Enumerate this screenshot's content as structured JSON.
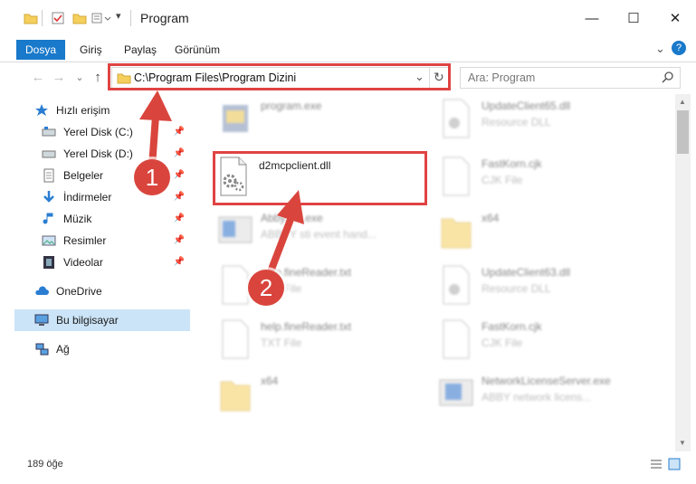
{
  "window": {
    "title": "Program",
    "minimize": "—",
    "maximize": "☐",
    "close": "✕"
  },
  "ribbon": {
    "tabs": [
      "Dosya",
      "Giriş",
      "Paylaş",
      "Görünüm"
    ],
    "expand": "⌄",
    "help": "?"
  },
  "navbar": {
    "back": "←",
    "forward": "→",
    "recent": "⌄",
    "up": "↑",
    "address": "C:\\Program Files\\Program Dizini",
    "dropdown": "⌄",
    "refresh": "↻",
    "search_placeholder": "Ara: Program"
  },
  "sidebar": {
    "quick_access": "Hızlı erişim",
    "items": [
      {
        "label": "Yerel Disk (C:)",
        "pinned": true
      },
      {
        "label": "Yerel Disk (D:)",
        "pinned": true
      },
      {
        "label": "Belgeler",
        "pinned": true
      },
      {
        "label": "İndirmeler",
        "pinned": true
      },
      {
        "label": "Müzik",
        "pinned": true
      },
      {
        "label": "Resimler",
        "pinned": true
      },
      {
        "label": "Videolar",
        "pinned": true
      }
    ],
    "onedrive": "OneDrive",
    "this_pc": "Bu bilgisayar",
    "network": "Ağ"
  },
  "files": [
    {
      "name": "program.exe",
      "type": ""
    },
    {
      "name": "UpdateClient65.dll",
      "type": "Resource DLL"
    },
    {
      "name": "d2mcpclient.dll",
      "type": ""
    },
    {
      "name": "FastKorn.cjk",
      "type": "CJK File"
    },
    {
      "name": "AbbySTI.exe",
      "type": "ABBYY sti event hand..."
    },
    {
      "name": "x64",
      "type": ""
    },
    {
      "name": "help.fineReader.txt",
      "type": "TXT File"
    },
    {
      "name": "UpdateClient63.dll",
      "type": "Resource DLL"
    },
    {
      "name": "help.fineReader.txt",
      "type": "TXT File"
    },
    {
      "name": "FastKorn.cjk",
      "type": "CJK File"
    },
    {
      "name": "x64",
      "type": ""
    },
    {
      "name": "NetworkLicenseServer.exe",
      "type": "ABBY network licens..."
    }
  ],
  "status": {
    "count": "189 öğe"
  },
  "annotations": {
    "step1": "1",
    "step2": "2"
  },
  "colors": {
    "accent": "#1979ca",
    "highlight": "#e04343",
    "step_badge": "#d9453d"
  }
}
